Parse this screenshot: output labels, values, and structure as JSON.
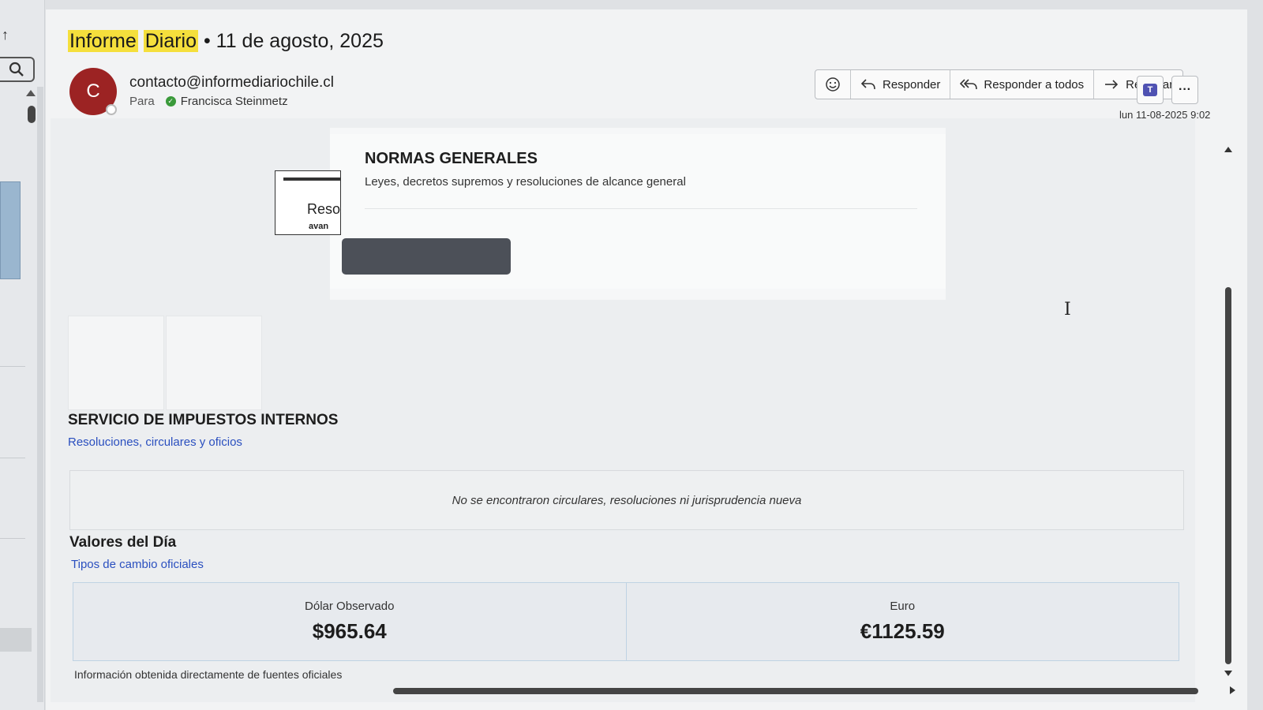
{
  "email": {
    "subject_highlight_1": "Informe",
    "subject_highlight_2": "Diario",
    "subject_rest": " • 11 de agosto, 2025",
    "avatar_letter": "C",
    "sender": "contacto@informediariochile.cl",
    "to_label": "Para",
    "recipient": "Francisca Steinmetz",
    "timestamp": "lun 11-08-2025 9:02"
  },
  "toolbar": {
    "reply": "Responder",
    "reply_all": "Responder a todos",
    "forward": "Reenviar",
    "more": "···",
    "emoji_icon": "smiley-icon",
    "teams_icon": "teams-icon"
  },
  "normas": {
    "image_text_1": "Reso",
    "image_text_2": "avan",
    "title": "NORMAS GENERALES",
    "subtitle": "Leyes, decretos supremos y resoluciones de alcance general"
  },
  "sii": {
    "title": "SERVICIO DE IMPUESTOS INTERNOS",
    "link": "Resoluciones, circulares y oficios",
    "empty_message": "No se encontraron circulares, resoluciones ni jurisprudencia nueva"
  },
  "valores": {
    "title": "Valores del Día",
    "link": "Tipos de cambio oficiales",
    "items": [
      {
        "label": "Dólar Observado",
        "value": "$965.64"
      },
      {
        "label": "Euro",
        "value": "€1125.59"
      }
    ],
    "footer": "Información obtenida directamente de fuentes oficiales"
  },
  "colors": {
    "avatar": "#9c2323",
    "link": "#2a4fbf",
    "highlight": "#f5df3c"
  }
}
